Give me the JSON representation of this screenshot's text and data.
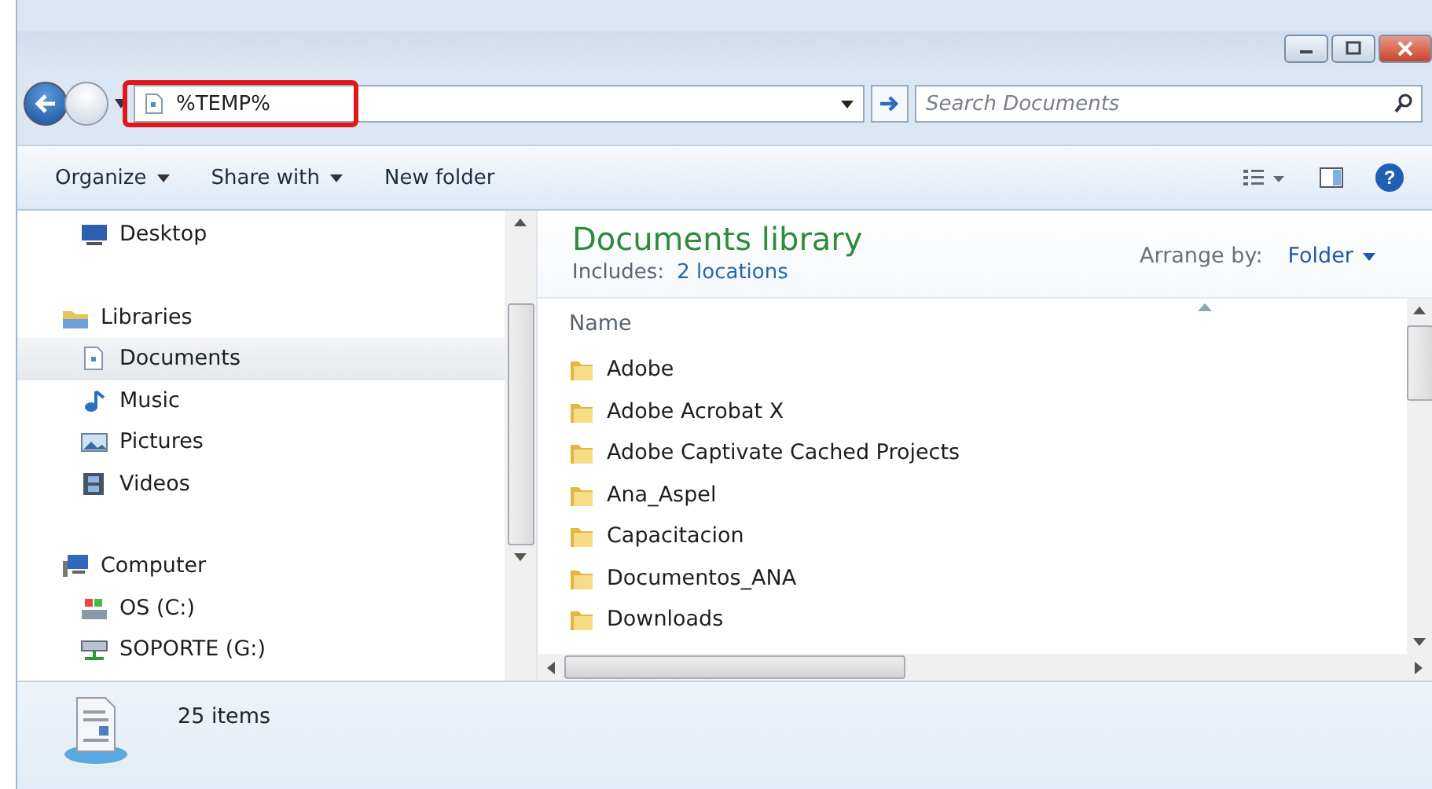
{
  "address_bar": {
    "value": "%TEMP%",
    "highlighted": true
  },
  "search": {
    "placeholder": "Search Documents"
  },
  "toolbar": {
    "buttons": [
      {
        "label": "Organize",
        "dropdown": true
      },
      {
        "label": "Share with",
        "dropdown": true
      },
      {
        "label": "New folder",
        "dropdown": false
      }
    ],
    "help_symbol": "?"
  },
  "sidebar": {
    "items": [
      {
        "label": "Desktop",
        "kind": "item",
        "selected": false
      },
      {
        "label": "Libraries",
        "kind": "group",
        "selected": false
      },
      {
        "label": "Documents",
        "kind": "item",
        "selected": true
      },
      {
        "label": "Music",
        "kind": "item",
        "selected": false
      },
      {
        "label": "Pictures",
        "kind": "item",
        "selected": false
      },
      {
        "label": "Videos",
        "kind": "item",
        "selected": false
      },
      {
        "label": "Computer",
        "kind": "group",
        "selected": false
      },
      {
        "label": "OS (C:)",
        "kind": "item",
        "selected": false
      },
      {
        "label": "SOPORTE (G:)",
        "kind": "item",
        "selected": false
      }
    ]
  },
  "library": {
    "title": "Documents library",
    "includes_label": "Includes:",
    "includes_link": "2 locations",
    "arrange_label": "Arrange by:",
    "arrange_value": "Folder"
  },
  "table": {
    "columns": [
      "Name"
    ],
    "rows": [
      "Adobe",
      "Adobe Acrobat X",
      "Adobe Captivate Cached Projects",
      "Ana_Aspel",
      "Capacitacion",
      "Documentos_ANA",
      "Downloads"
    ]
  },
  "status_bar": {
    "count": "25 items"
  }
}
